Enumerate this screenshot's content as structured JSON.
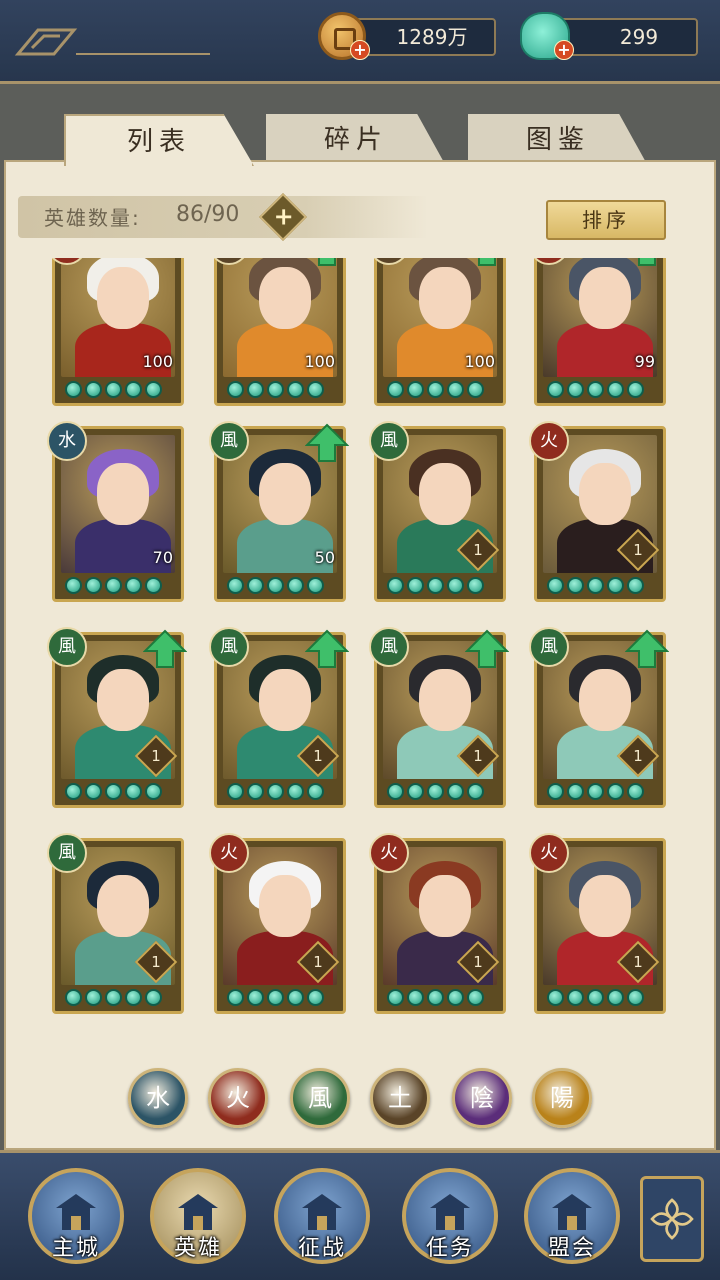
{
  "header": {
    "coins": "1289万",
    "jade": "299"
  },
  "tabs": [
    {
      "label": "列表",
      "active": true
    },
    {
      "label": "碎片",
      "active": false
    },
    {
      "label": "图鉴",
      "active": false
    }
  ],
  "hero_count": {
    "label": "英雄数量:",
    "value": "86/90"
  },
  "sort_label": "排序",
  "elements": {
    "water": {
      "glyph": "水",
      "color": "#2c5466"
    },
    "fire": {
      "glyph": "火",
      "color": "#8f2c1e"
    },
    "wind": {
      "glyph": "風",
      "color": "#2f6a3b"
    },
    "earth": {
      "glyph": "土",
      "color": "#5a4428"
    },
    "yin": {
      "glyph": "陰",
      "color": "#5b2d7a"
    },
    "yang": {
      "glyph": "陽",
      "color": "#b9821a"
    }
  },
  "heroes": [
    {
      "element": "fire",
      "level": "100",
      "upgrade": false,
      "hair": "#f1efe9",
      "body": "#a8261c",
      "bg": "#7a5f2c"
    },
    {
      "element": "earth",
      "level": "100",
      "upgrade": true,
      "hair": "#6b5340",
      "body": "#e08a2c",
      "bg": "#8c6a30"
    },
    {
      "element": "earth",
      "level": "100",
      "upgrade": true,
      "hair": "#6b5340",
      "body": "#e08a2c",
      "bg": "#8c6a30"
    },
    {
      "element": "fire",
      "level": "99",
      "upgrade": true,
      "hair": "#4a5566",
      "body": "#b0262a",
      "bg": "#4a3a2a"
    },
    {
      "element": "water",
      "level": "70",
      "upgrade": false,
      "hair": "#8a63c7",
      "body": "#3a2f6a",
      "bg": "#4a3a3a"
    },
    {
      "element": "wind",
      "level": "50",
      "upgrade": true,
      "hair": "#1c2a3a",
      "body": "#5a9e8c",
      "bg": "#6a5a2a"
    },
    {
      "element": "wind",
      "level": "1",
      "upgrade": false,
      "hair": "#4a3022",
      "body": "#2a7a5a",
      "bg": "#6e5a2c"
    },
    {
      "element": "fire",
      "level": "1",
      "upgrade": false,
      "hair": "#e6e6e6",
      "body": "#2a1e1e",
      "bg": "#6a5a3a"
    },
    {
      "element": "wind",
      "level": "1",
      "upgrade": true,
      "hair": "#1e2e2a",
      "body": "#2e8a70",
      "bg": "#6e5a2c"
    },
    {
      "element": "wind",
      "level": "1",
      "upgrade": true,
      "hair": "#1e2e2a",
      "body": "#2e8a70",
      "bg": "#6e5a2c"
    },
    {
      "element": "wind",
      "level": "1",
      "upgrade": true,
      "hair": "#2a2a2e",
      "body": "#8ec9b8",
      "bg": "#5e4a2a"
    },
    {
      "element": "wind",
      "level": "1",
      "upgrade": true,
      "hair": "#2a2a2e",
      "body": "#8ec9b8",
      "bg": "#5e4a2a"
    },
    {
      "element": "wind",
      "level": "1",
      "upgrade": false,
      "hair": "#1c2a3a",
      "body": "#5a9e8c",
      "bg": "#6a5a2a"
    },
    {
      "element": "fire",
      "level": "1",
      "upgrade": false,
      "hair": "#f4f4f4",
      "body": "#8a1e1e",
      "bg": "#5a3a2a"
    },
    {
      "element": "fire",
      "level": "1",
      "upgrade": false,
      "hair": "#8a3a22",
      "body": "#3a2a4a",
      "bg": "#5a3a2a"
    },
    {
      "element": "fire",
      "level": "1",
      "upgrade": false,
      "hair": "#4a5566",
      "body": "#b0262a",
      "bg": "#4a3a2a"
    }
  ],
  "filters": [
    "water",
    "fire",
    "wind",
    "earth",
    "yin",
    "yang"
  ],
  "nav": [
    {
      "label": "主城",
      "icon": "castle-icon",
      "active": false
    },
    {
      "label": "英雄",
      "icon": "hero-portrait-icon",
      "active": true
    },
    {
      "label": "征战",
      "icon": "battle-drum-icon",
      "active": false
    },
    {
      "label": "任务",
      "icon": "scroll-icon",
      "active": false
    },
    {
      "label": "盟会",
      "icon": "pavilion-icon",
      "active": false
    }
  ],
  "more_icon": "flower-menu-icon"
}
